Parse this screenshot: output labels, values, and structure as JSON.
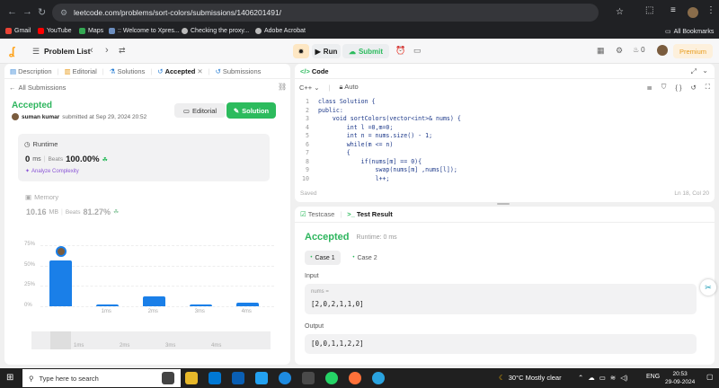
{
  "browser": {
    "url": "leetcode.com/problems/sort-colors/submissions/1406201491/",
    "bookmarks": [
      "Gmail",
      "YouTube",
      "Maps",
      ":: Welcome to Xpres...",
      "Checking the proxy...",
      "Adobe Acrobat"
    ],
    "all_bookmarks": "All Bookmarks"
  },
  "header": {
    "problem_list": "Problem List",
    "run": "Run",
    "submit": "Submit",
    "streak": "0",
    "premium": "Premium"
  },
  "left": {
    "tabs": [
      "Description",
      "Editorial",
      "Solutions",
      "Accepted",
      "Submissions"
    ],
    "back": "All Submissions",
    "status": "Accepted",
    "user": "suman kumar",
    "submitted": "submitted at Sep 29, 2024 20:52",
    "editorial_btn": "Editorial",
    "solution_btn": "Solution",
    "runtime_label": "Runtime",
    "runtime_value": "0",
    "runtime_unit": "ms",
    "beats_label": "Beats",
    "runtime_beats": "100.00%",
    "analyze": "Analyze Complexity",
    "memory_label": "Memory",
    "memory_value": "10.16",
    "memory_unit": "MB",
    "memory_beats": "81.27%"
  },
  "chart_data": {
    "type": "bar",
    "categories": [
      "",
      "1ms",
      "2ms",
      "3ms",
      "4ms"
    ],
    "values": [
      56,
      2,
      12,
      2,
      4
    ],
    "ylabel_ticks": [
      "75%",
      "50%",
      "25%",
      "0%"
    ],
    "ylim": [
      0,
      75
    ],
    "overview_labels": [
      "1ms",
      "2ms",
      "3ms",
      "4ms"
    ]
  },
  "code": {
    "title": "Code",
    "lang": "C++",
    "mode": "Auto",
    "lines": [
      "class Solution {",
      "public:",
      "    void sortColors(vector<int>& nums) {",
      "        int l =0,m=0;",
      "        int n = nums.size() - 1;",
      "        while(m <= n)",
      "        {",
      "            if(nums[m] == 0){",
      "                swap(nums[m] ,nums[l]);",
      "                l++;"
    ],
    "saved": "Saved",
    "cursor": "Ln 18, Col 20"
  },
  "result": {
    "tabs": [
      "Testcase",
      "Test Result"
    ],
    "status": "Accepted",
    "runtime": "Runtime: 0 ms",
    "cases": [
      "Case 1",
      "Case 2"
    ],
    "input_label": "Input",
    "var_label": "nums =",
    "input": "[2,0,2,1,1,0]",
    "output_label": "Output",
    "output": "[0,0,1,1,2,2]"
  },
  "taskbar": {
    "search": "Type here to search",
    "weather": "30°C  Mostly clear",
    "lang": "ENG",
    "time": "20:53",
    "date": "29-09-2024"
  },
  "colors": {
    "accent": "#2cbb5d",
    "bar": "#1a7fe8",
    "accepted": "#2db55d"
  }
}
